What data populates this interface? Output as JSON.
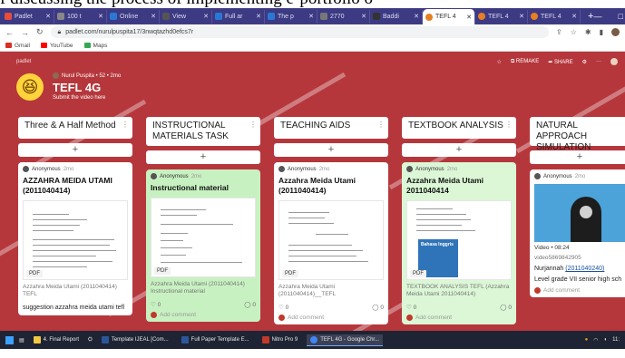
{
  "caption": "f discussing the process of implementing e-portfolio o",
  "browser": {
    "tabs": [
      {
        "label": "Padlet",
        "color": "#e74c3c"
      },
      {
        "label": "100 t",
        "color": "#888"
      },
      {
        "label": "Online",
        "color": "#2a78d6"
      },
      {
        "label": "View",
        "color": "#555"
      },
      {
        "label": "Full ar",
        "color": "#2a78d6"
      },
      {
        "label": "The p",
        "color": "#2a78d6"
      },
      {
        "label": "2770",
        "color": "#777"
      },
      {
        "label": "Baddi",
        "color": "#333"
      },
      {
        "label": "TEFL 4",
        "color": "#e67e22",
        "active": true
      },
      {
        "label": "TEFL 4",
        "color": "#e67e22"
      },
      {
        "label": "TEFL 4",
        "color": "#e67e22"
      }
    ],
    "url": "padlet.com/nurulpuspita17/3nwqtazhd0efcs7r",
    "bookmarks": [
      {
        "label": "Gmail",
        "color": "#d93025"
      },
      {
        "label": "YouTube",
        "color": "#ff0000"
      },
      {
        "label": "Maps",
        "color": "#34a853"
      }
    ]
  },
  "padlet": {
    "brand": "padlet",
    "author": "Nurul Puspita • 52 • 2mo",
    "title": "TEFL 4G",
    "subtitle": "Submit the video here",
    "actions": [
      "REMAKE",
      "SHARE"
    ],
    "columns": [
      {
        "title": "Three & A Half Method",
        "card": {
          "author": "Anonymous",
          "time": "2mo",
          "title": "AZZAHRA MEIDA UTAMI (2011040414)",
          "caption": "Azzahra Meida Utami (2011040414) TEFL",
          "text": "suggestion azzahra meida utami tefl",
          "badge": "PDF"
        }
      },
      {
        "title": "INSTRUCTIONAL MATERIALS TASK",
        "card": {
          "author": "Anonymous",
          "time": "2mo",
          "title": "Instructional material",
          "caption": "Azzahra Meida Utami (2011040414) Instructional material",
          "badge": "PDF",
          "likes": "0",
          "comments": "0",
          "add_comment": "Add comment"
        }
      },
      {
        "title": "TEACHING AIDS",
        "card": {
          "author": "Anonymous",
          "time": "2mo",
          "title": "Azzahra Meida Utami (2011040414)",
          "caption": "Azzahra Meida Utami (2011040414)__TEFL",
          "badge": "PDF",
          "likes": "0",
          "comments": "0",
          "add_comment": "Add comment"
        }
      },
      {
        "title": "TEXTBOOK ANALYSIS",
        "card": {
          "author": "Anonymous",
          "time": "2mo",
          "title": "Azzahra Meida Utami 2011040414",
          "caption": "TEXTBOOK ANALYSIS TEFL (Azzahra Meida Utami 2011040414)",
          "badge": "PDF",
          "book": "Bahasa Inggris",
          "likes": "0",
          "comments": "0",
          "add_comment": "Add comment"
        }
      },
      {
        "title": "NATURAL APPROACH SIMULATION",
        "card": {
          "author": "Anonymous",
          "time": "2mo",
          "video_label": "Video • 08:24",
          "video_file": "video5869842905",
          "name": "Nurjannah",
          "nim": "(2011040240)",
          "desc": "Level grade VII senior high sch",
          "add_comment": "Add comment"
        }
      }
    ]
  },
  "taskbar": {
    "items": [
      {
        "label": "4. Final Report",
        "color": "#f2c744"
      },
      {
        "label": "Template IJEAL [Com...",
        "color": "#2b579a"
      },
      {
        "label": "Full Paper Template E...",
        "color": "#2b579a"
      },
      {
        "label": "Nitro Pro 9",
        "color": "#c0392b"
      },
      {
        "label": "TEFL 4G - Google Chr...",
        "color": "#4285f4",
        "active": true
      }
    ],
    "clock": "11:"
  }
}
